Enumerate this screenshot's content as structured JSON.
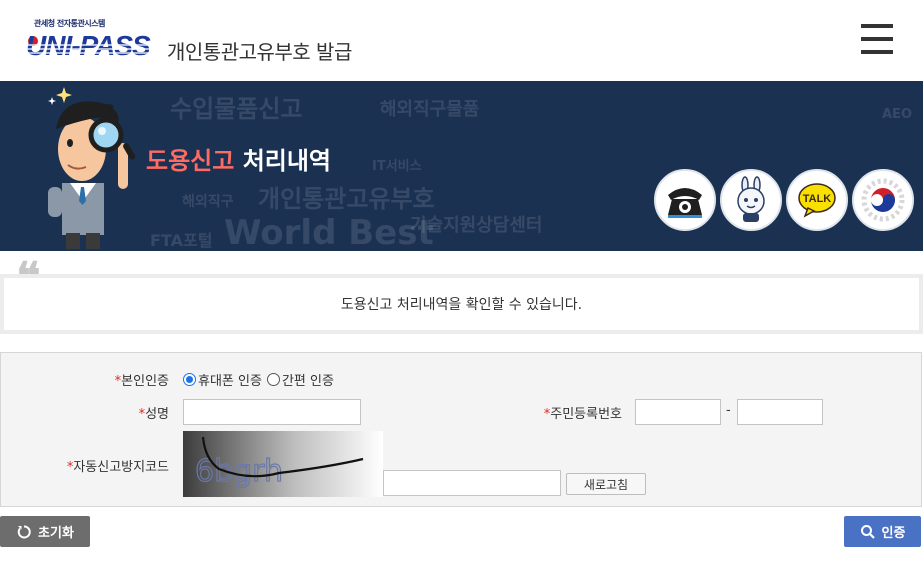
{
  "header": {
    "logo_sub": "관세청 전자통관시스템",
    "logo_main": "UNI-PASS",
    "title": "개인통관고유부호 발급"
  },
  "banner": {
    "title_highlight": "도용신고",
    "title_rest": "처리내역",
    "bg_words": [
      "수입물품신고",
      "해외직구물품",
      "개인통관고유부호",
      "World Best",
      "기술지원상담센터",
      "FTA포털",
      "해외직구",
      "AEO",
      "IT서비스"
    ],
    "quick_icons": [
      "phone-icon",
      "chatbot-icon",
      "kakaotalk-icon",
      "korea-gov-icon"
    ],
    "talk_label": "TALK"
  },
  "info": {
    "message": "도용신고 처리내역을 확인할 수 있습니다."
  },
  "form": {
    "required_mark": "*",
    "auth_label": "본인인증",
    "auth_options": [
      "휴대폰 인증",
      "간편 인증"
    ],
    "auth_selected": "휴대폰 인증",
    "name_label": "성명",
    "name_value": "",
    "rrn_label": "주민등록번호",
    "rrn_separator": "-",
    "rrn_front": "",
    "rrn_back": "",
    "captcha_label": "자동신고방지코드",
    "captcha_text": "6bgrh",
    "captcha_input": "",
    "refresh_label": "새로고침"
  },
  "buttons": {
    "reset_label": "초기화",
    "auth_label": "인증"
  },
  "colors": {
    "banner_bg": "#1b3152",
    "highlight": "#ff6b62",
    "required": "#e0291c",
    "auth_button": "#4a72c4",
    "reset_button": "#6d6d6d"
  }
}
